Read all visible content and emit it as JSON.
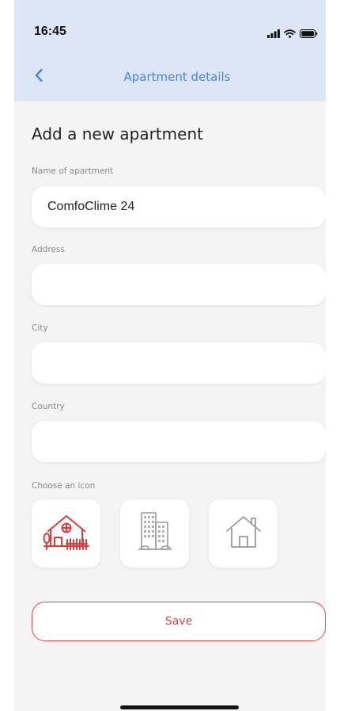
{
  "status_bar": {
    "time": "16:45",
    "icons": [
      "signal-icon",
      "wifi-icon",
      "battery-icon"
    ]
  },
  "nav": {
    "back_icon": "chevron-left-icon",
    "title": "Apartment details"
  },
  "page": {
    "title": "Add a new apartment"
  },
  "form": {
    "name": {
      "label": "Name of apartment",
      "value": "ComfoClime 24",
      "placeholder": ""
    },
    "address": {
      "label": "Address",
      "value": "",
      "placeholder": ""
    },
    "city": {
      "label": "City",
      "value": "",
      "placeholder": ""
    },
    "country": {
      "label": "Country",
      "value": "",
      "placeholder": ""
    }
  },
  "icon_chooser": {
    "label": "Choose an icon",
    "options": [
      {
        "name": "house-garden-icon",
        "selected": true
      },
      {
        "name": "apartment-building-icon",
        "selected": false
      },
      {
        "name": "house-outline-icon",
        "selected": false
      }
    ]
  },
  "actions": {
    "save_label": "Save"
  },
  "colors": {
    "accent": "#3f86e6",
    "danger": "#e04646",
    "header_bg": "#dde6f4",
    "page_bg": "#f4f4f4"
  }
}
